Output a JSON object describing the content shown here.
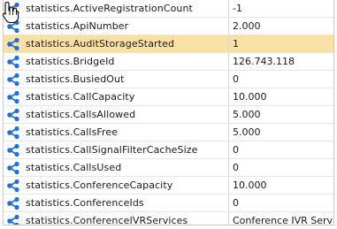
{
  "rows": [
    {
      "name": "statistics.ActiveRegistrationCount",
      "value": "-1",
      "selected": false
    },
    {
      "name": "statistics.ApiNumber",
      "value": "2.000",
      "selected": false
    },
    {
      "name": "statistics.AuditStorageStarted",
      "value": "1",
      "selected": true
    },
    {
      "name": "statistics.BridgeId",
      "value": "126.743.118",
      "selected": false
    },
    {
      "name": "statistics.BusiedOut",
      "value": "0",
      "selected": false
    },
    {
      "name": "statistics.CallCapacity",
      "value": "10.000",
      "selected": false
    },
    {
      "name": "statistics.CallsAllowed",
      "value": "5.000",
      "selected": false
    },
    {
      "name": "statistics.CallsFree",
      "value": "5.000",
      "selected": false
    },
    {
      "name": "statistics.CallSignalFilterCacheSize",
      "value": "0",
      "selected": false
    },
    {
      "name": "statistics.CallsUsed",
      "value": "0",
      "selected": false
    },
    {
      "name": "statistics.ConferenceCapacity",
      "value": "10.000",
      "selected": false
    },
    {
      "name": "statistics.ConferenceIds",
      "value": "0",
      "selected": false
    },
    {
      "name": "statistics.ConferenceIVRServices",
      "value": "Conference IVR Service,",
      "selected": false
    }
  ],
  "colors": {
    "selected_row": "#fbe0a6",
    "icon": "#1e6fd9"
  },
  "icons": {
    "row_icon": "share-node-icon",
    "cursor": "hand-pointer-icon"
  }
}
